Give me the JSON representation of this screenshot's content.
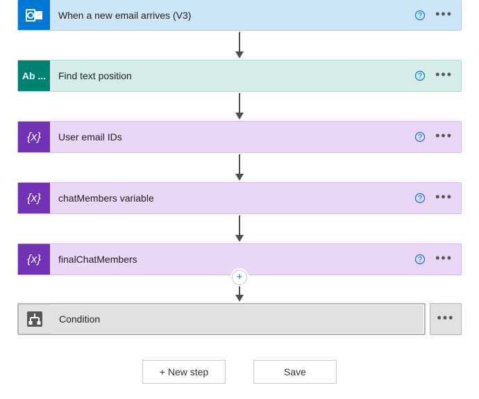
{
  "steps": [
    {
      "label": "When a new email arrives (V3)",
      "kind": "outlook"
    },
    {
      "label": "Find text position",
      "kind": "teal"
    },
    {
      "label": "User email IDs",
      "kind": "purple"
    },
    {
      "label": "chatMembers variable",
      "kind": "purple"
    },
    {
      "label": "finalChatMembers",
      "kind": "purple"
    }
  ],
  "condition": {
    "label": "Condition"
  },
  "footer": {
    "new_step_label": "+ New step",
    "save_label": "Save"
  },
  "icons": {
    "ab_text": "Ab ..."
  }
}
